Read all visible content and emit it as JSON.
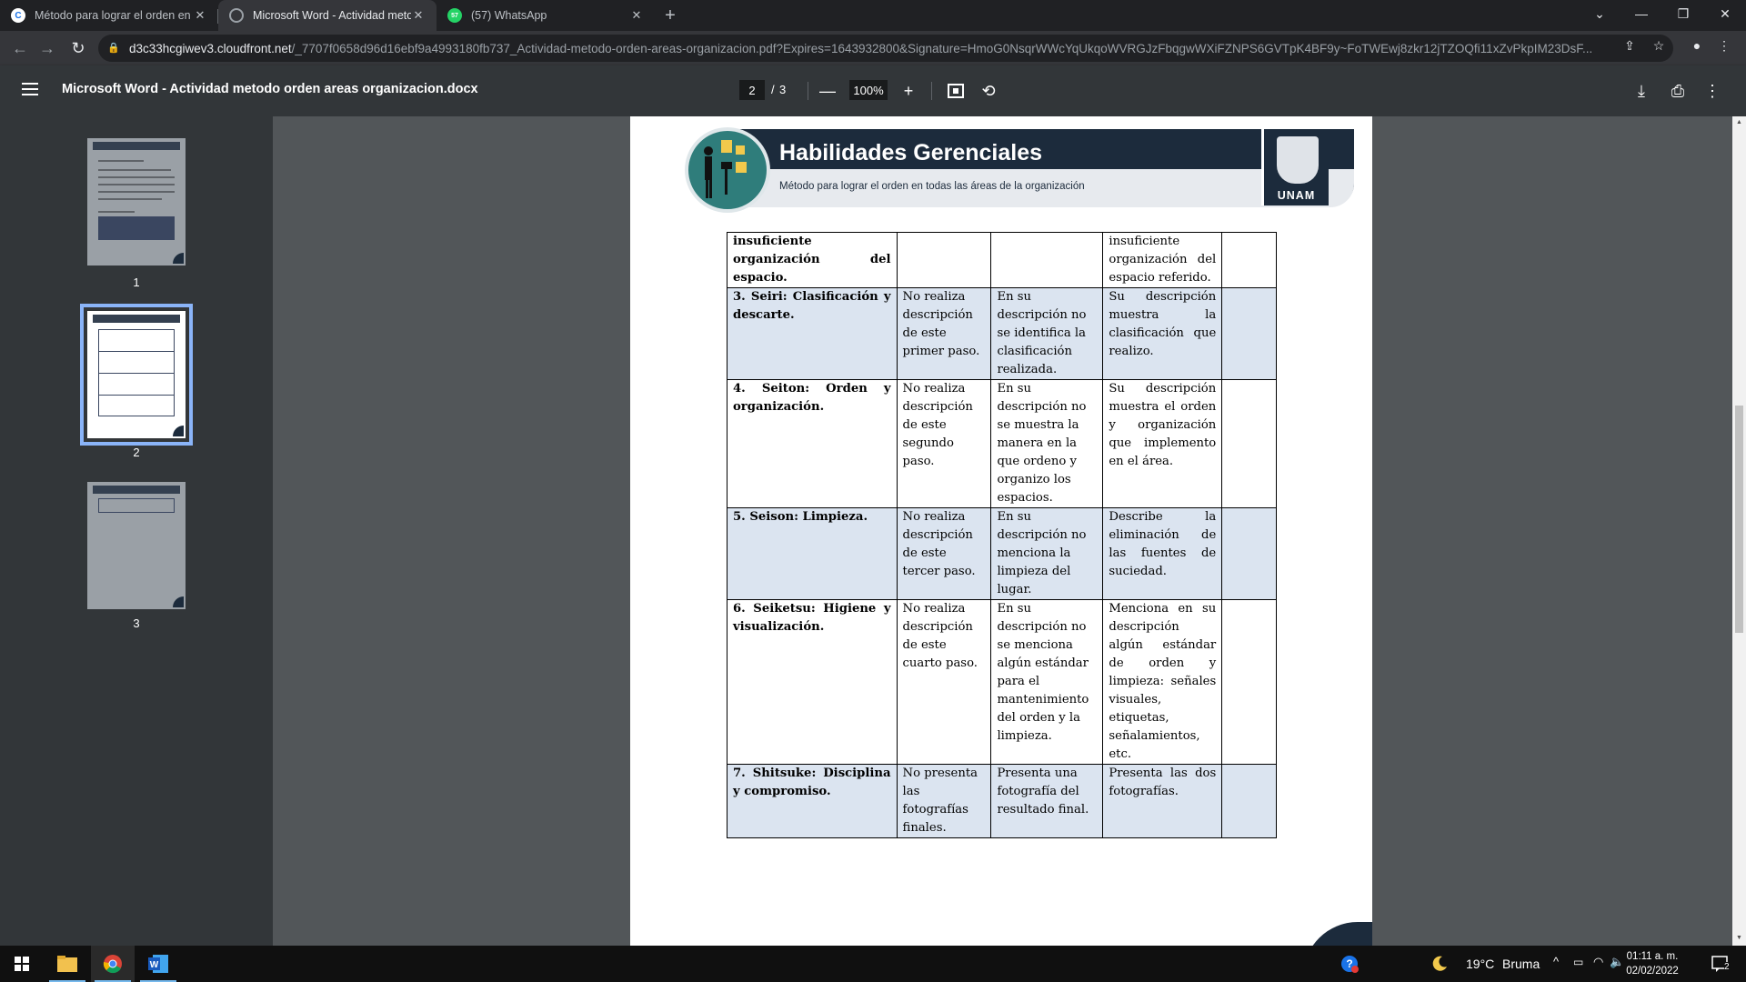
{
  "browser": {
    "tabs": [
      {
        "title": "Método para lograr el orden en t",
        "favicon": "C",
        "favicon_color": "#1a73e8",
        "active": false
      },
      {
        "title": "Microsoft Word - Actividad meto",
        "favicon": "",
        "favicon_color": "#9aa0a6",
        "active": true
      },
      {
        "title": "(57) WhatsApp",
        "favicon": "57",
        "favicon_color": "#25d366",
        "active": false
      }
    ],
    "url_host": "d3c33hcgiwev3.cloudfront.net",
    "url_rest": "/_7707f0658d96d16ebf9a4993180fb737_Actividad-metodo-orden-areas-organizacion.pdf?Expires=1643932800&Signature=HmoG0NsqrWWcYqUkqoWVRGJzFbqgwWXiFZNPS6GVTpK4BF9y~FoTWEwj8zkr12jTZOQfi11xZvPkpIM23DsF..."
  },
  "pdf_viewer": {
    "document_title": "Microsoft Word - Actividad metodo orden areas organizacion.docx",
    "current_page": "2",
    "page_separator": "/",
    "total_pages": "3",
    "zoom": "100%",
    "thumbnails": [
      {
        "label": "1"
      },
      {
        "label": "2"
      },
      {
        "label": "3"
      }
    ]
  },
  "document": {
    "header_title": "Habilidades Gerenciales",
    "header_subtitle": "Método para lograr el orden en todas las áreas de la organización",
    "logo_label": "UNAM",
    "rubric_rows": [
      {
        "criterion": "insuficiente organización del espacio.",
        "c1": "",
        "c2": "",
        "c3": "insuficiente organización del espacio referido.",
        "c4": "",
        "shaded": false
      },
      {
        "criterion": "3. Seiri: Clasificación y descarte.",
        "c1": "No realiza descripción de este primer paso.",
        "c2": "En su descripción no se identifica la clasificación realizada.",
        "c3": "Su descripción muestra la clasificación que realizo.",
        "c4": "",
        "shaded": true
      },
      {
        "criterion": "4. Seiton: Orden y organización.",
        "c1": "No realiza descripción de este segundo paso.",
        "c2": "En su descripción no se muestra la manera en la que ordeno y organizo los espacios.",
        "c3": "Su descripción muestra el orden y organización que implemento en el área.",
        "c4": "",
        "shaded": false
      },
      {
        "criterion": "5. Seison: Limpieza.",
        "c1": "No realiza descripción de este tercer paso.",
        "c2": "En su descripción no menciona la limpieza del lugar.",
        "c3": "Describe la eliminación de las fuentes de suciedad.",
        "c4": "",
        "shaded": true
      },
      {
        "criterion": "6. Seiketsu: Higiene y visualización.",
        "c1": "No realiza descripción de este cuarto paso.",
        "c2": "En su descripción no se menciona algún estándar para el mantenimiento del orden y la limpieza.",
        "c3": "Menciona en su descripción algún estándar de orden y limpieza: señales visuales, etiquetas, señalamientos, etc.",
        "c4": "",
        "shaded": false
      },
      {
        "criterion": "7. Shitsuke: Disciplina y compromiso.",
        "c1": "No presenta las fotografías finales.",
        "c2": "Presenta una fotografía del resultado final.",
        "c3": "Presenta las dos fotografías.",
        "c4": "",
        "shaded": true
      }
    ]
  },
  "taskbar": {
    "weather_temp": "19°C",
    "weather_desc": "Bruma",
    "time": "01:11 a. m.",
    "date": "02/02/2022",
    "notification_count": "2"
  },
  "colors": {
    "accent_blue": "#8ab4f8",
    "banner_navy": "#1c2b3c",
    "table_shade": "#dbe4f0"
  }
}
